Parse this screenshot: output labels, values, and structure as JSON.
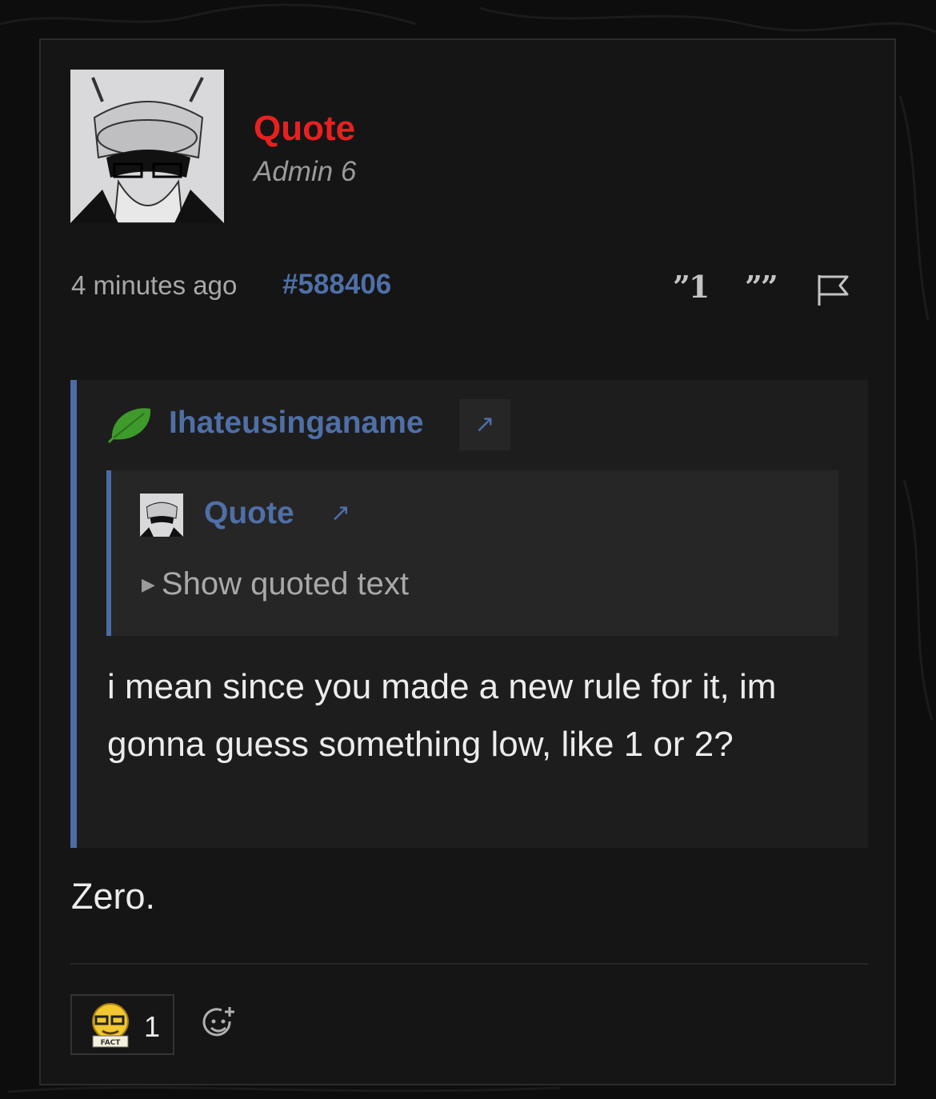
{
  "post": {
    "author": "Quote",
    "author_title": "Admin 6",
    "timestamp": "4 minutes ago",
    "post_number": "#588406",
    "actions": {
      "quote_one": "”1",
      "quote_all": "””"
    },
    "body": "Zero."
  },
  "quote": {
    "author": "Ihateusinganame",
    "link_icon": "↗",
    "nested": {
      "author": "Quote",
      "link_icon": "↗",
      "show_label": "Show quoted text",
      "toggle_icon": "▶"
    },
    "text": "i mean since you made a new rule for it, im gonna guess something low, like 1 or 2?"
  },
  "reactions": [
    {
      "icon": "fact-emoji",
      "label": "FACT",
      "count": "1"
    }
  ],
  "colors": {
    "accent_blue": "#4f6fa6",
    "username_red": "#e8201f",
    "background": "#151515"
  }
}
